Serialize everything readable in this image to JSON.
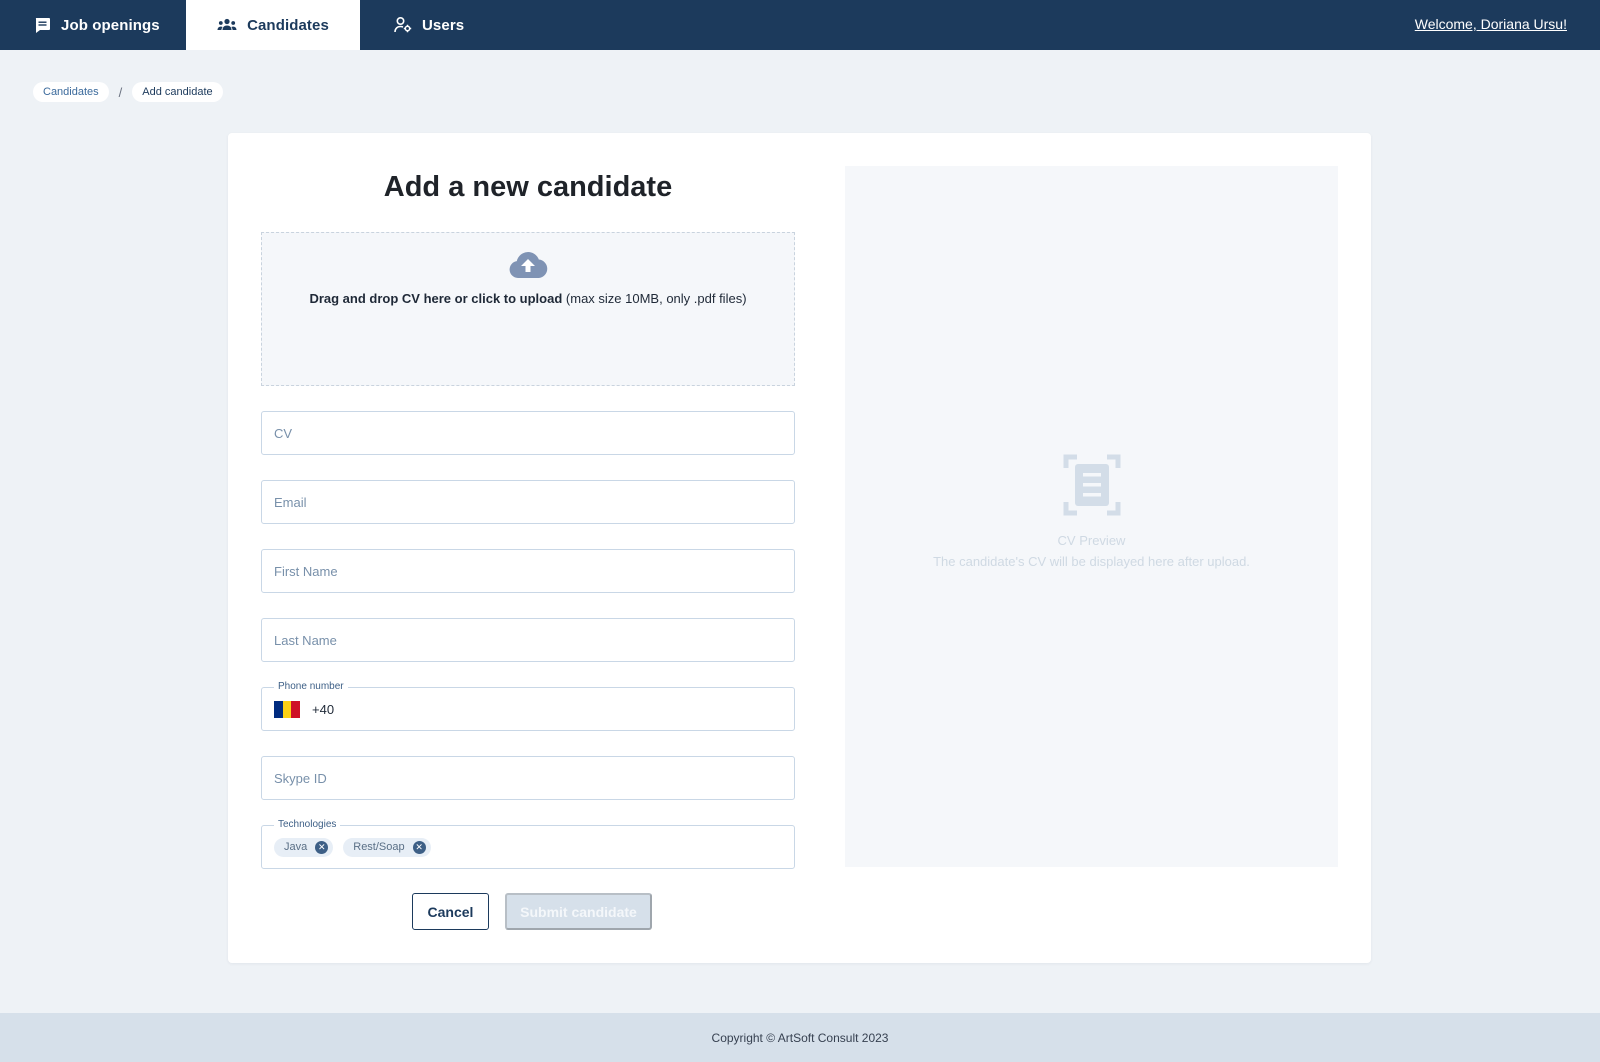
{
  "nav": {
    "tabs": [
      {
        "label": "Job openings",
        "icon": "message-square-icon",
        "active": false
      },
      {
        "label": "Candidates",
        "icon": "users-group-icon",
        "active": true
      },
      {
        "label": "Users",
        "icon": "user-settings-icon",
        "active": false
      }
    ],
    "welcome": "Welcome, Doriana Ursu!"
  },
  "breadcrumb": {
    "parent": "Candidates",
    "separator": "/",
    "current": "Add candidate"
  },
  "form": {
    "title": "Add a new candidate",
    "upload": {
      "bold": "Drag and drop CV here or click to upload",
      "hint": "(max size 10MB, only .pdf files)",
      "icon": "cloud-upload-icon"
    },
    "cv_placeholder": "CV",
    "email_placeholder": "Email",
    "first_name_placeholder": "First Name",
    "last_name_placeholder": "Last Name",
    "phone": {
      "label": "Phone number",
      "country_flag": "romania-flag",
      "value": "+40"
    },
    "skype_placeholder": "Skype ID",
    "technologies": {
      "label": "Technologies",
      "chips": [
        "Java",
        "Rest/Soap"
      ]
    },
    "cancel_label": "Cancel",
    "submit_label": "Submit candidate"
  },
  "preview": {
    "title": "CV Preview",
    "subtitle": "The candidate's CV will be displayed here after upload.",
    "icon": "document-scan-icon"
  },
  "footer": {
    "copyright": "Copyright © ArtSoft Consult 2023"
  },
  "colors": {
    "nav_bg": "#1c3a5c",
    "page_bg": "#eef2f6",
    "footer_bg": "#d6e0ea",
    "accent": "#3d5f86"
  }
}
